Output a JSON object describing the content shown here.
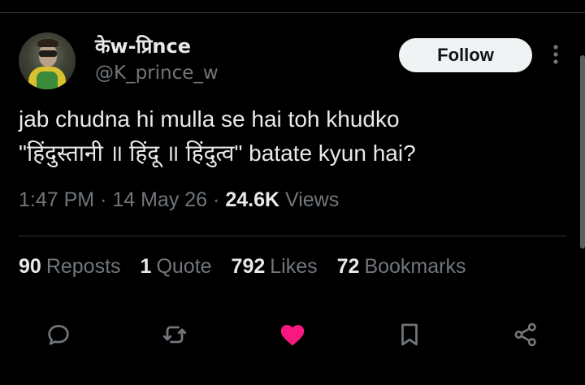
{
  "author": {
    "name": "केw-प्रिnce",
    "handle": "@K_prince_w"
  },
  "follow_label": "Follow",
  "tweet": {
    "line1": "jab chudna hi mulla se hai toh khudko",
    "line2": "\"हिंदुस्तानी ॥ हिंदू ॥ हिंदुत्व\" batate kyun hai?"
  },
  "meta": {
    "time": "1:47 PM",
    "date": "14 May 26",
    "views_count": "24.6K",
    "views_label": "Views"
  },
  "stats": [
    {
      "num": "90",
      "label": "Reposts"
    },
    {
      "num": "1",
      "label": "Quote"
    },
    {
      "num": "792",
      "label": "Likes"
    },
    {
      "num": "72",
      "label": "Bookmarks"
    }
  ],
  "icons": {
    "reply": "comment-icon",
    "repost": "repost-icon",
    "like": "heart-icon",
    "bookmark": "bookmark-icon",
    "share": "share-icon",
    "more": "more-icon"
  },
  "colors": {
    "like_active": "#f91880",
    "secondary_text": "#71767b",
    "primary_text": "#e7e9ea",
    "follow_bg": "#eff3f4"
  }
}
